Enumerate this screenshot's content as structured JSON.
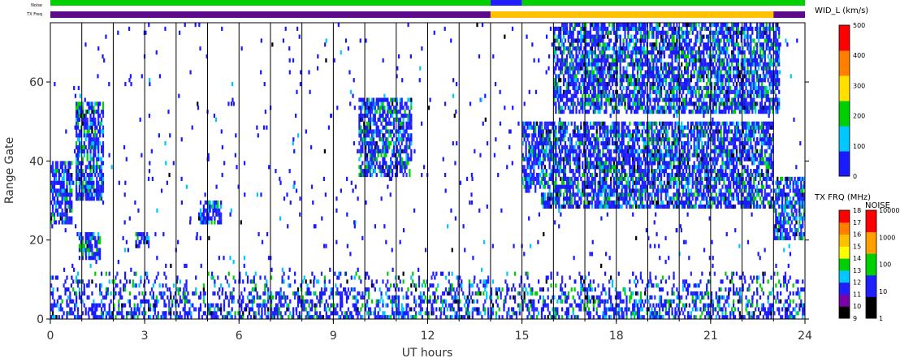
{
  "chart_data": {
    "type": "heatmap",
    "xlabel": "UT hours",
    "ylabel": "Range Gate",
    "xlim": [
      0,
      24
    ],
    "ylim": [
      0,
      75
    ],
    "x_ticks": [
      "0",
      "3",
      "6",
      "9",
      "12",
      "15",
      "18",
      "21",
      "24"
    ],
    "y_ticks": [
      "0",
      "20",
      "40",
      "60"
    ],
    "strip_labels": {
      "noise": "Noise",
      "txfreq": "TX Freq"
    },
    "noise_strip": [
      {
        "from": 0,
        "to": 14,
        "level": "100"
      },
      {
        "from": 14,
        "to": 15,
        "level": "10"
      },
      {
        "from": 15,
        "to": 24,
        "level": "100"
      }
    ],
    "txfreq_strip": [
      {
        "from": 0,
        "to": 14,
        "level": "10"
      },
      {
        "from": 14,
        "to": 23,
        "level": "14"
      },
      {
        "from": 23,
        "to": 24,
        "level": "10"
      }
    ],
    "echo_regions": [
      {
        "x": [
          0.0,
          0.7
        ],
        "y": [
          24,
          40
        ]
      },
      {
        "x": [
          0.9,
          1.6
        ],
        "y": [
          15,
          22
        ]
      },
      {
        "x": [
          0.8,
          1.7
        ],
        "y": [
          30,
          55
        ]
      },
      {
        "x": [
          2.7,
          3.1
        ],
        "y": [
          18,
          22
        ]
      },
      {
        "x": [
          4.7,
          5.4
        ],
        "y": [
          24,
          30
        ]
      },
      {
        "x": [
          9.8,
          11.5
        ],
        "y": [
          36,
          56
        ]
      },
      {
        "x": [
          15.0,
          15.6
        ],
        "y": [
          32,
          50
        ]
      },
      {
        "x": [
          15.6,
          23.0
        ],
        "y": [
          28,
          50
        ]
      },
      {
        "x": [
          16.0,
          23.2
        ],
        "y": [
          52,
          75
        ]
      },
      {
        "x": [
          23.0,
          24.0
        ],
        "y": [
          20,
          36
        ]
      },
      {
        "x": [
          0.0,
          24.0
        ],
        "y": [
          0,
          12
        ]
      }
    ],
    "vertical_lines": [
      1,
      2,
      3,
      4,
      5,
      6,
      7,
      8,
      9,
      10,
      11,
      12,
      13,
      14,
      15,
      16,
      17,
      18,
      19,
      20,
      21,
      22,
      23
    ],
    "colorbars": [
      {
        "title": "WID_L (km/s)",
        "ticks": [
          "0",
          "100",
          "200",
          "300",
          "400",
          "500"
        ],
        "colors": [
          "#1a1aff",
          "#00c8ff",
          "#00d000",
          "#ffe000",
          "#ff8000",
          "#ff0000"
        ]
      },
      {
        "title": "TX FRQ (MHz)",
        "ticks": [
          "9",
          "10",
          "11",
          "12",
          "13",
          "14",
          "15",
          "16",
          "17",
          "18"
        ],
        "colors": [
          "#000000",
          "#7a00a8",
          "#2020ff",
          "#00c8ff",
          "#00d000",
          "#ffff00",
          "#ffc000",
          "#ff8000",
          "#ff0000"
        ]
      },
      {
        "title": "NOISE",
        "ticks": [
          "1",
          "10",
          "100",
          "1000",
          "10000"
        ],
        "colors": [
          "#000000",
          "#2020ff",
          "#00d000",
          "#ffa000",
          "#ff0000"
        ]
      }
    ]
  }
}
